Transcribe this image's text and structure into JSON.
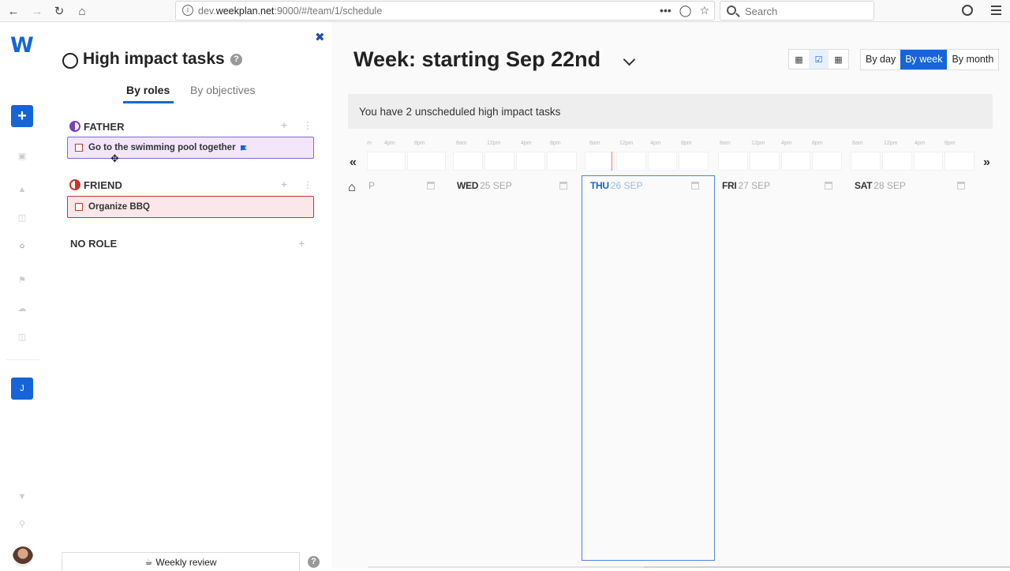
{
  "browser": {
    "url_prefix": "dev.",
    "url_domain": "weekplan.net",
    "url_suffix": ":9000/#/team/1/schedule",
    "search_placeholder": "Search",
    "more_glyph": "•••"
  },
  "rail": {
    "logo": "W",
    "add_glyph": "+",
    "user_initial": "J"
  },
  "panel": {
    "title": "High impact tasks",
    "help_glyph": "?",
    "close_glyph": "✖",
    "tabs": [
      {
        "label": "By roles"
      },
      {
        "label": "By objectives"
      }
    ],
    "roles": [
      {
        "name": "FATHER",
        "tasks": [
          {
            "label": "Go to the swimming pool together"
          }
        ]
      },
      {
        "name": "FRIEND",
        "tasks": [
          {
            "label": "Organize BBQ"
          }
        ]
      }
    ],
    "no_role": "NO ROLE",
    "add_glyph": "+",
    "more_glyph": "⋮",
    "weekly_review": "Weekly review"
  },
  "main": {
    "week_title": "Week: starting Sep 22nd",
    "ranges": [
      {
        "label": "By day"
      },
      {
        "label": "By week"
      },
      {
        "label": "By month"
      }
    ],
    "active_range": "By week",
    "banner": "You have 2 unscheduled high impact tasks",
    "prev_glyph": "«",
    "next_glyph": "»",
    "mini_labels": [
      "8am",
      "12pm",
      "4pm",
      "8pm"
    ],
    "days": [
      {
        "dow": "",
        "date": "P"
      },
      {
        "dow": "WED",
        "date": "25 SEP"
      },
      {
        "dow": "THU",
        "date": "26 SEP"
      },
      {
        "dow": "FRI",
        "date": "27 SEP"
      },
      {
        "dow": "SAT",
        "date": "28 SEP"
      }
    ],
    "accent_color": "#1565d8"
  }
}
